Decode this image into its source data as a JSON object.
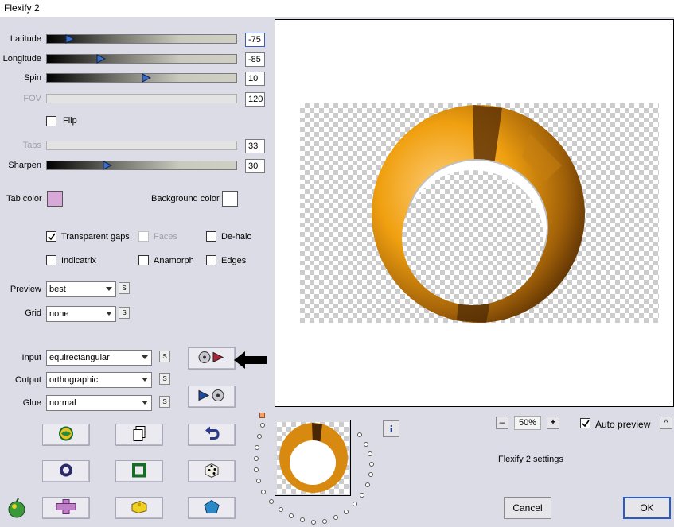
{
  "window": {
    "title": "Flexify 2"
  },
  "params": {
    "latitude": {
      "label": "Latitude",
      "value": "-75",
      "position": 0.1
    },
    "longitude": {
      "label": "Longitude",
      "value": "-85",
      "position": 0.275
    },
    "spin": {
      "label": "Spin",
      "value": "10",
      "position": 0.525
    },
    "fov": {
      "label": "FOV",
      "value": "120"
    },
    "flip": {
      "label": "Flip",
      "checked": false
    },
    "tabs": {
      "label": "Tabs",
      "value": "33"
    },
    "sharpen": {
      "label": "Sharpen",
      "value": "30",
      "position": 0.31
    }
  },
  "colors": {
    "tab_color": {
      "label": "Tab color",
      "value": "#d8a8d8"
    },
    "background_color": {
      "label": "Background color",
      "value": "#ffffff"
    }
  },
  "options": {
    "transparent_gaps": {
      "label": "Transparent gaps",
      "checked": true
    },
    "faces": {
      "label": "Faces",
      "checked": false,
      "disabled": true
    },
    "de_halo": {
      "label": "De-halo",
      "checked": false
    },
    "indicatrix": {
      "label": "Indicatrix",
      "checked": false
    },
    "anamorph": {
      "label": "Anamorph",
      "checked": false
    },
    "edges": {
      "label": "Edges",
      "checked": false
    }
  },
  "dropdowns": {
    "preview": {
      "label": "Preview",
      "value": "best"
    },
    "grid": {
      "label": "Grid",
      "value": "none"
    },
    "input": {
      "label": "Input",
      "value": "equirectangular"
    },
    "output": {
      "label": "Output",
      "value": "orthographic"
    },
    "glue": {
      "label": "Glue",
      "value": "normal"
    },
    "s_label": "S"
  },
  "icons": {
    "convert_in": "disc-to-arrow-icon",
    "convert_out": "arrow-to-disc-icon",
    "arrow_pointer": "black-arrow-icon",
    "grid_buttons": [
      "globe-icon",
      "copy-icon",
      "undo-icon",
      "ring-icon",
      "square-frame-icon",
      "dice-icon",
      "plus-shape-icon",
      "block-icon",
      "pentagon-icon"
    ],
    "logo": "flexify-logo-icon",
    "info": "info-icon"
  },
  "bottom": {
    "zoom_value": "50%",
    "zoom_minus": "–",
    "zoom_plus": "+",
    "info_label": "i",
    "auto_preview": {
      "label": "Auto preview",
      "checked": true
    },
    "collapse_label": "^",
    "settings_label": "Flexify 2 settings",
    "cancel": "Cancel",
    "ok": "OK"
  },
  "accent_color": "#f0a010"
}
